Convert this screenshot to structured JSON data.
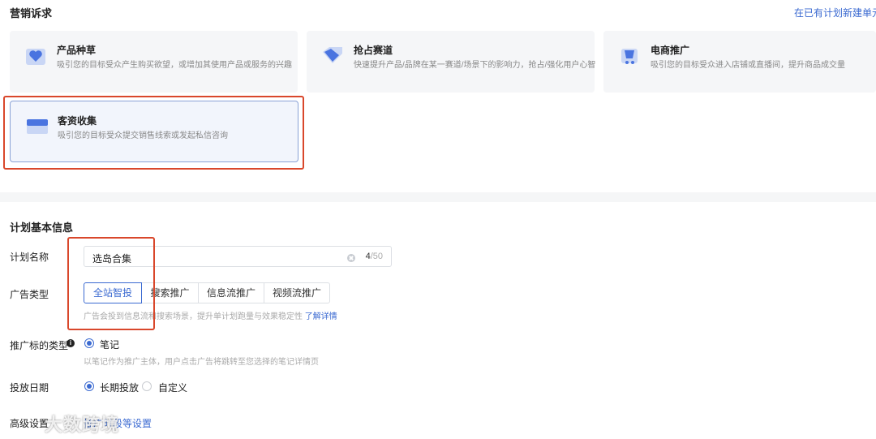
{
  "marketing": {
    "title": "营销诉求",
    "new_link": "在已有计划新建单元",
    "cards": [
      {
        "title": "产品种草",
        "desc": "吸引您的目标受众产生购买欲望，或增加其使用产品或服务的兴趣",
        "icon": "heart-box-icon"
      },
      {
        "title": "抢占赛道",
        "desc": "快速提升产品/品牌在某一赛道/场景下的影响力，抢占/强化用户心智",
        "icon": "diamond-icon"
      },
      {
        "title": "电商推广",
        "desc": "吸引您的目标受众进入店铺或直播间，提升商品成交量",
        "icon": "cart-icon"
      },
      {
        "title": "客资收集",
        "desc": "吸引您的目标受众提交销售线索或发起私信咨询",
        "icon": "card-icon"
      }
    ]
  },
  "plan": {
    "title": "计划基本信息",
    "name_label": "计划名称",
    "name_value": "选岛合集",
    "name_count": "4",
    "name_max": "/50",
    "ad_type_label": "广告类型",
    "ad_types": [
      "全站智投",
      "搜索推广",
      "信息流推广",
      "视频流推广"
    ],
    "ad_type_hint": "广告会投到信息流和搜索场景，提升单计划跑量与效果稳定性",
    "ad_type_hint_link": "了解详情",
    "target_label": "推广标的类型",
    "target_option": "笔记",
    "target_hint": "以笔记作为推广主体，用户点击广告将跳转至您选择的笔记详情页",
    "date_label": "投放日期",
    "date_options": [
      "长期投放",
      "自定义"
    ],
    "advanced_label": "高级设置",
    "advanced_link": "推广时段等设置"
  },
  "watermark": "大数跨境",
  "colors": {
    "accent": "#3b6ad1",
    "highlight_box": "#d9472b"
  }
}
